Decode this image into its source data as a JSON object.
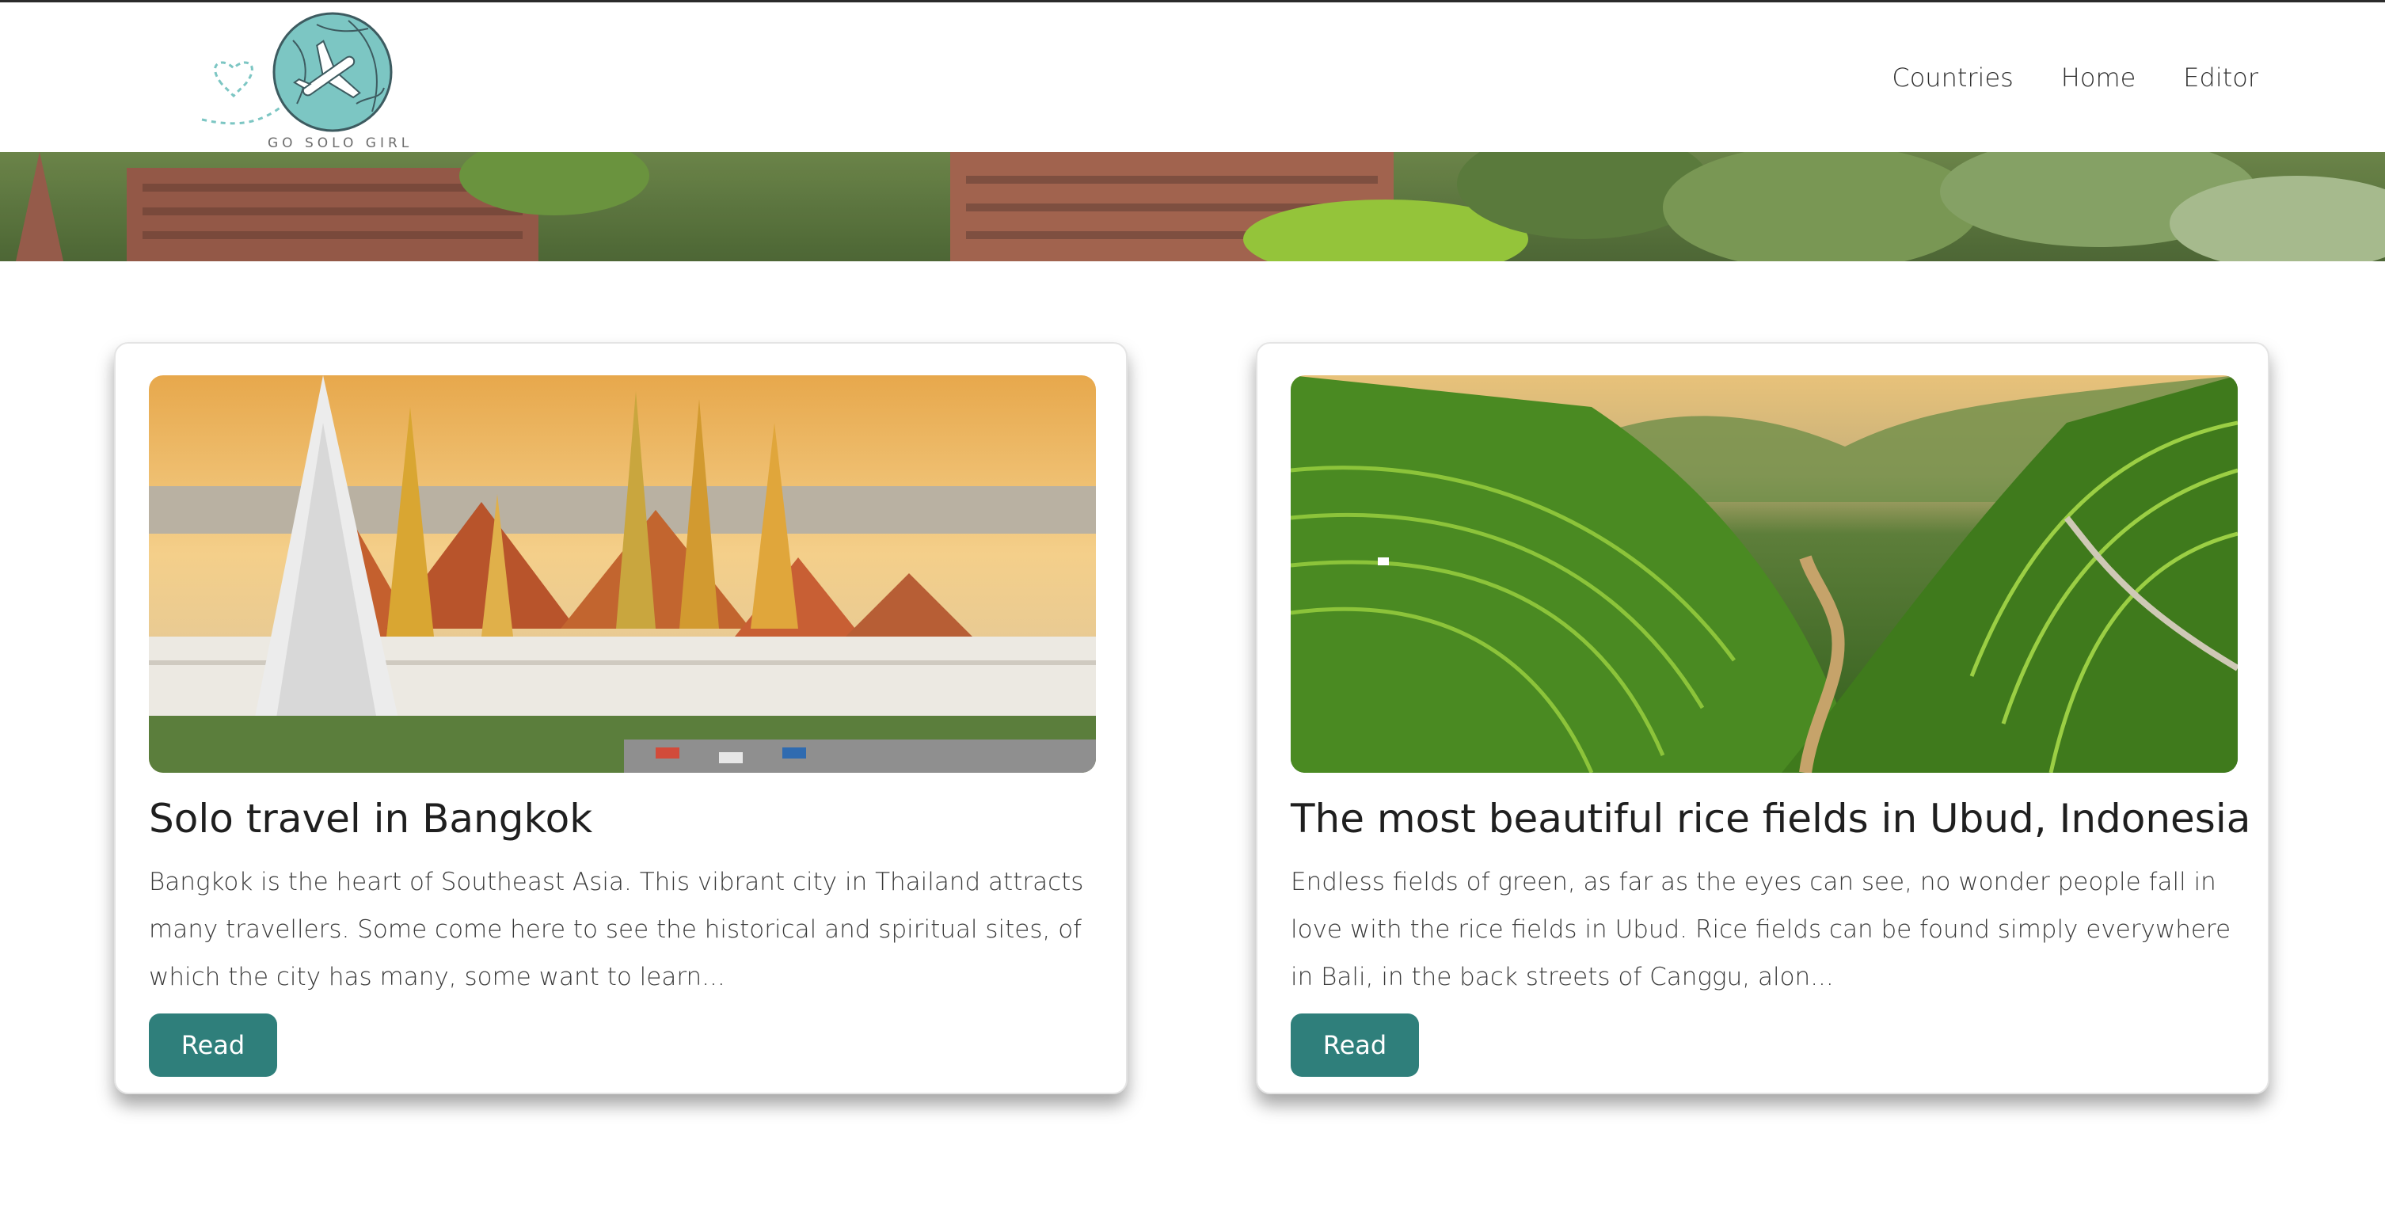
{
  "brand": {
    "name": "GO SOLO GIRL"
  },
  "nav": {
    "items": [
      {
        "label": "Countries"
      },
      {
        "label": "Home"
      },
      {
        "label": "Editor"
      }
    ]
  },
  "posts": [
    {
      "title": "Solo travel in Bangkok",
      "excerpt": "Bangkok is the heart of Southeast Asia. This vibrant city in Thailand attracts many travellers. Some come here to see the historical and spiritual sites, of which the city has many, some want to learn...",
      "button": "Read"
    },
    {
      "title": "The most beautiful rice fields in Ubud, Indonesia",
      "excerpt": "Endless fields of green, as far as the eyes can see, no wonder people fall in love with the rice fields in Ubud. Rice fields can be found simply everywhere in Bali, in the back streets of Canggu, alon...",
      "button": "Read"
    }
  ],
  "colors": {
    "accent": "#2f7f7b",
    "logo_globe": "#7cc6c3"
  }
}
